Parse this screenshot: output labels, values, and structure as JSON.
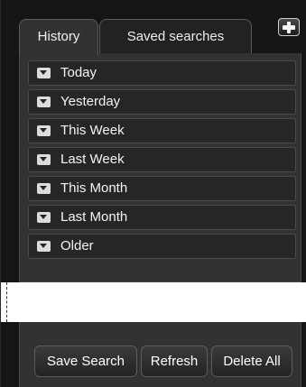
{
  "tabs": {
    "history_label": "History",
    "saved_searches_label": "Saved searches"
  },
  "icons": {
    "pin": "pin-icon",
    "group_caret": "caret-down-icon"
  },
  "history_groups": [
    {
      "label": "Today"
    },
    {
      "label": "Yesterday"
    },
    {
      "label": "This Week"
    },
    {
      "label": "Last Week"
    },
    {
      "label": "This Month"
    },
    {
      "label": "Last Month"
    },
    {
      "label": "Older"
    }
  ],
  "buttons": {
    "save_search": "Save Search",
    "refresh": "Refresh",
    "delete_all": "Delete All"
  },
  "colors": {
    "panel_background": "#151515",
    "content_background": "#323232",
    "row_background": "#262626",
    "text": "#f4f4f4"
  }
}
